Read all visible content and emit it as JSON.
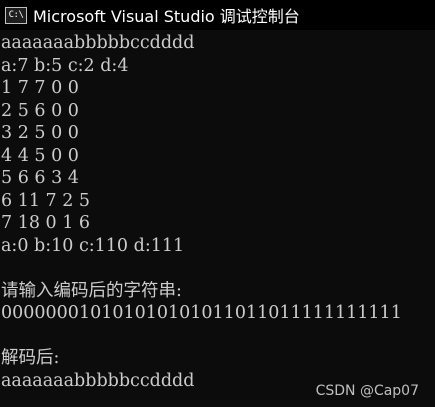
{
  "window": {
    "title": "Microsoft Visual Studio 调试控制台",
    "icon": "console-app-icon",
    "icon_text": "C:\\"
  },
  "console": {
    "lines": [
      "aaaaaaabbbbbccdddd",
      "a:7 b:5 c:2 d:4",
      "1 7 7 0 0",
      "2 5 6 0 0",
      "3 2 5 0 0",
      "4 4 5 0 0",
      "5 6 6 3 4",
      "6 11 7 2 5",
      "7 18 0 1 6",
      "a:0 b:10 c:110 d:111",
      "",
      "请输入编码后的字符串:",
      "000000010101010101011011011111111111",
      "",
      "解码后:",
      "aaaaaaabbbbbccdddd"
    ]
  },
  "watermark": "CSDN @Cap07",
  "colors": {
    "background": "#0c0c0c",
    "titlebar": "#000000",
    "text": "#cccccc"
  }
}
